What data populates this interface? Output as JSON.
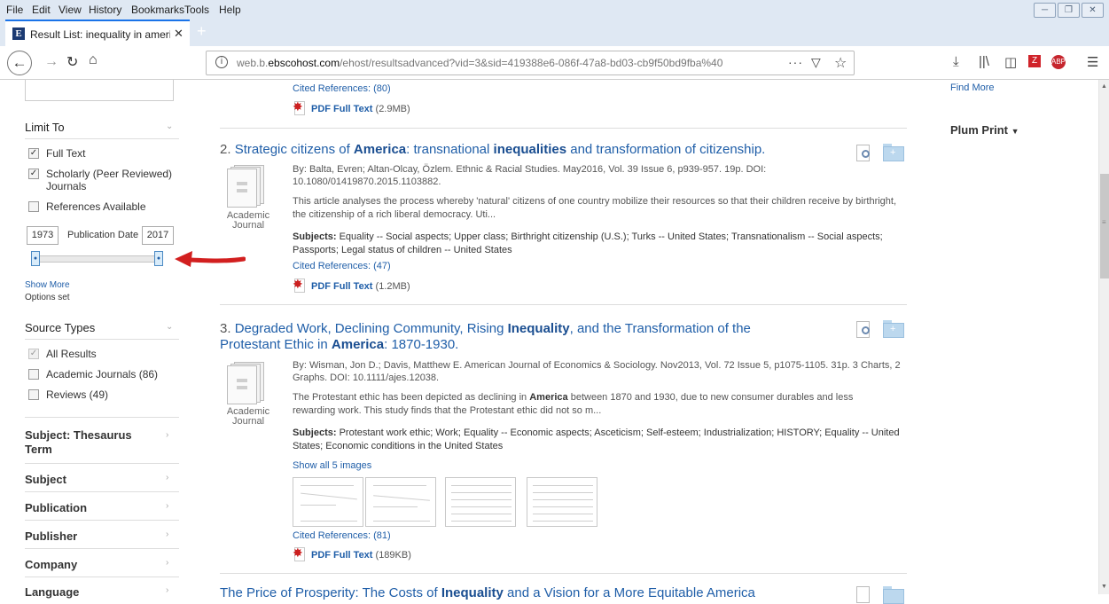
{
  "menubar": [
    "File",
    "Edit",
    "View",
    "History",
    "Bookmarks",
    "Tools",
    "Help"
  ],
  "tab": {
    "title": "Result List: inequality in americ",
    "favicon": "E"
  },
  "url": {
    "prefix": "web.b.",
    "host": "ebscohost.com",
    "path": "/ehost/resultsadvanced?vid=3&sid=419388e6-086f-47a8-bd03-cb9f50bd9fba%40"
  },
  "sidebar": {
    "limit_to": "Limit To",
    "limit_options": [
      {
        "label": "Full Text",
        "checked": true
      },
      {
        "label": "Scholarly (Peer Reviewed)",
        "label2": "Journals",
        "checked": true
      },
      {
        "label": "References Available",
        "checked": false
      }
    ],
    "pub_date": {
      "from": "1973",
      "label": "Publication Date",
      "to": "2017"
    },
    "show_more": "Show More",
    "options_set": "Options set",
    "source_types": "Source Types",
    "source_options": [
      {
        "label": "All Results",
        "checked": true
      },
      {
        "label": "Academic Journals (86)",
        "checked": false
      },
      {
        "label": "Reviews (49)",
        "checked": false
      }
    ],
    "facets": [
      "Subject: Thesaurus",
      "Term",
      "Subject",
      "Publication",
      "Publisher",
      "Company",
      "Language"
    ]
  },
  "results": {
    "r1_cited": "Cited References: (80)",
    "r1_pdf": "PDF Full Text",
    "r1_pdf_size": "(2.9MB)",
    "r2": {
      "num": "2.",
      "title_parts": [
        "Strategic citizens of ",
        "America",
        ": transnational ",
        "inequalities",
        " and transformation of citizenship."
      ],
      "meta1": "By: Balta, Evren; Altan-Olcay, Özlem. Ethnic & Racial Studies. May2016, Vol. 39 Issue 6, p939-957. 19p. DOI:",
      "meta2": "10.1080/01419870.2015.1103882.",
      "abstract1": "This article analyses the process whereby 'natural' citizens of one country mobilize their resources so that their children receive by birthright,",
      "abstract2": "the citizenship of a rich liberal democracy. Uti...",
      "subjects_label": "Subjects:",
      "subjects1": " Equality -- Social aspects; Upper class; Birthright citizenship (U.S.); Turks -- United States; Transnationalism -- Social aspects;",
      "subjects2": "Passports; Legal status of children -- United States",
      "cited": "Cited References: (47)",
      "pdf": "PDF Full Text",
      "pdf_size": "(1.2MB)",
      "doctype1": "Academic",
      "doctype2": "Journal"
    },
    "r3": {
      "num": "3.",
      "title_line1": [
        "Degraded Work, Declining Community, Rising ",
        "Inequality",
        ", and the Transformation of the"
      ],
      "title_line2": [
        "Protestant Ethic in ",
        "America",
        ": 1870-1930."
      ],
      "meta1": "By: Wisman, Jon D.; Davis, Matthew E. American Journal of Economics & Sociology. Nov2013, Vol. 72 Issue 5, p1075-1105. 31p. 3 Charts, 2",
      "meta2": "Graphs. DOI: 10.1111/ajes.12038.",
      "abstract1_a": "The Protestant ethic has been depicted as declining in ",
      "abstract1_b": "America",
      "abstract1_c": " between 1870 and 1930, due to new consumer durables and less",
      "abstract2": "rewarding work. This study finds that the Protestant ethic did not so m...",
      "subjects_label": "Subjects:",
      "subjects1": " Protestant work ethic; Work; Equality -- Economic aspects; Asceticism; Self-esteem; Industrialization; HISTORY; Equality -- United",
      "subjects2": "States; Economic conditions in the United States",
      "show_images": "Show all 5 images",
      "cited": "Cited References: (81)",
      "pdf": "PDF Full Text",
      "pdf_size": "(189KB)",
      "doctype1": "Academic",
      "doctype2": "Journal"
    },
    "r4_partial": [
      "The Price of Prosperity: The Costs of ",
      "Inequality",
      " and a Vision for a More Equitable America"
    ]
  },
  "right_panel": {
    "find_more": "Find More",
    "plum_print": "Plum Print"
  },
  "colors": {
    "link": "#1f5ea8",
    "arrow": "#d21f1f",
    "chrome": "#dfe8f3"
  }
}
